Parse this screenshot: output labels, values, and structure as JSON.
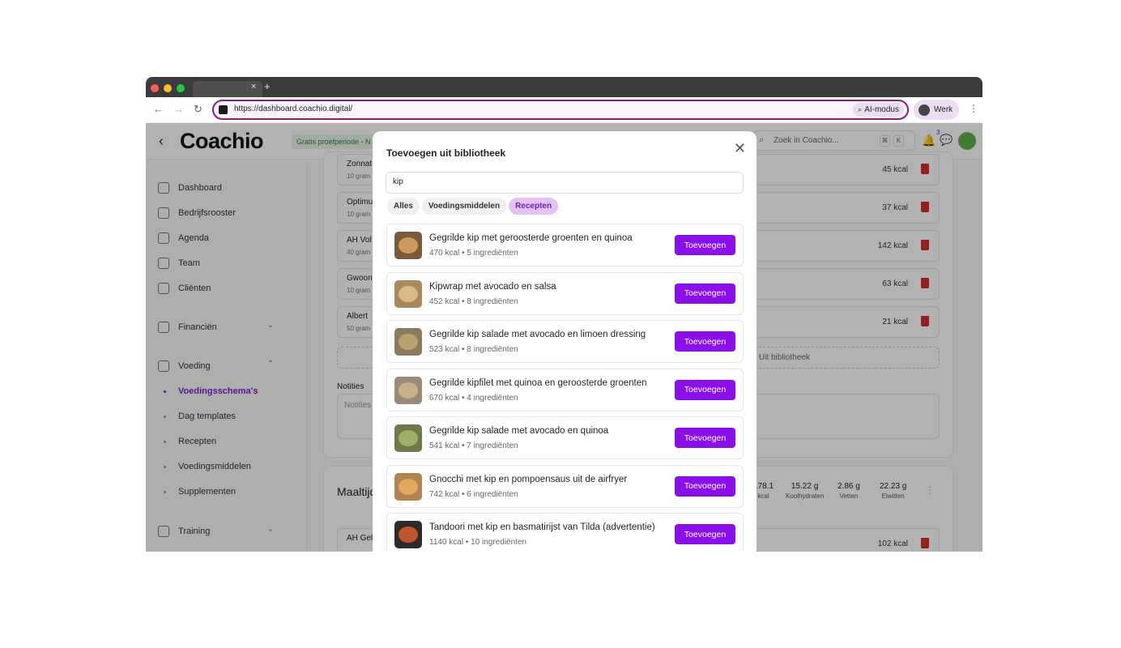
{
  "browser": {
    "url": "https://dashboard.coachio.digital/",
    "ai_mode_label": "AI-modus",
    "profile_label": "Werk",
    "tab_close": "×",
    "tab_new": "+"
  },
  "app": {
    "logo": "Coachio",
    "trial_badge": "Gratis proefperiode - N",
    "search_placeholder": "Zoek in Coachio...",
    "search_shortcut": [
      "⌘",
      "K"
    ],
    "chat_badge_count": "3"
  },
  "sidebar": {
    "items": [
      {
        "label": "Dashboard"
      },
      {
        "label": "Bedrijfsrooster"
      },
      {
        "label": "Agenda"
      },
      {
        "label": "Team"
      },
      {
        "label": "Cliënten"
      },
      {
        "label": "Financiën"
      },
      {
        "label": "Voeding"
      },
      {
        "label": "Training"
      }
    ],
    "sub_items": [
      {
        "label": "Voedingsschema's",
        "active": true
      },
      {
        "label": "Dag templates"
      },
      {
        "label": "Recepten"
      },
      {
        "label": "Voedingsmiddelen"
      },
      {
        "label": "Supplementen"
      }
    ]
  },
  "background": {
    "food_rows": [
      {
        "name": "Zonnat",
        "amount": "10 gram",
        "kcal": "45 kcal"
      },
      {
        "name": "Optimu",
        "amount": "10 gram",
        "kcal": "37 kcal"
      },
      {
        "name": "AH Vol",
        "amount": "40 gram",
        "kcal": "142 kcal"
      },
      {
        "name": "Gwoon",
        "amount": "10 gram",
        "kcal": "63 kcal"
      },
      {
        "name": "Albert",
        "amount": "50 gram",
        "kcal": "21 kcal"
      }
    ],
    "library_button": "Uit bibliotheek",
    "notes_label": "Notities",
    "notes_placeholder": "Notities",
    "meal_title": "Maaltijd",
    "macros": [
      {
        "value": "178.1",
        "label": "kcal"
      },
      {
        "value": "15.22 g",
        "label": "Koolhydraten"
      },
      {
        "value": "2.86 g",
        "label": "Vetten"
      },
      {
        "value": "22.23 g",
        "label": "Eiwitten"
      }
    ],
    "last_row": {
      "name": "AH Gel",
      "kcal": "102 kcal"
    }
  },
  "modal": {
    "title": "Toevoegen uit bibliotheek",
    "search_value": "kip",
    "filters": [
      {
        "label": "Alles"
      },
      {
        "label": "Voedingsmiddelen"
      },
      {
        "label": "Recepten",
        "active": true
      }
    ],
    "add_label": "Toevoegen",
    "results": [
      {
        "name": "Gegrilde kip met geroosterde groenten en quinoa",
        "meta": "470 kcal • 5 ingrediënten"
      },
      {
        "name": "Kipwrap met avocado en salsa",
        "meta": "452 kcal • 8 ingrediënten"
      },
      {
        "name": "Gegrilde kip salade met avocado en limoen dressing",
        "meta": "523 kcal • 8 ingrediënten"
      },
      {
        "name": "Gegrilde kipfilet met quinoa en geroosterde groenten",
        "meta": "670 kcal • 4 ingrediënten"
      },
      {
        "name": "Gegrilde kip salade met avocado en quinoa",
        "meta": "541 kcal • 7 ingrediënten"
      },
      {
        "name": "Gnocchi met kip en pompoensaus uit de airfryer",
        "meta": "742 kcal • 6 ingrediënten"
      },
      {
        "name": "Tandoori met kip en basmatirijst van Tilda (advertentie)",
        "meta": "1140 kcal • 10 ingrediënten"
      }
    ]
  },
  "colors": {
    "accent": "#8b0fe8",
    "accent_soft": "#e4c2f5",
    "danger": "#d32f2f"
  }
}
